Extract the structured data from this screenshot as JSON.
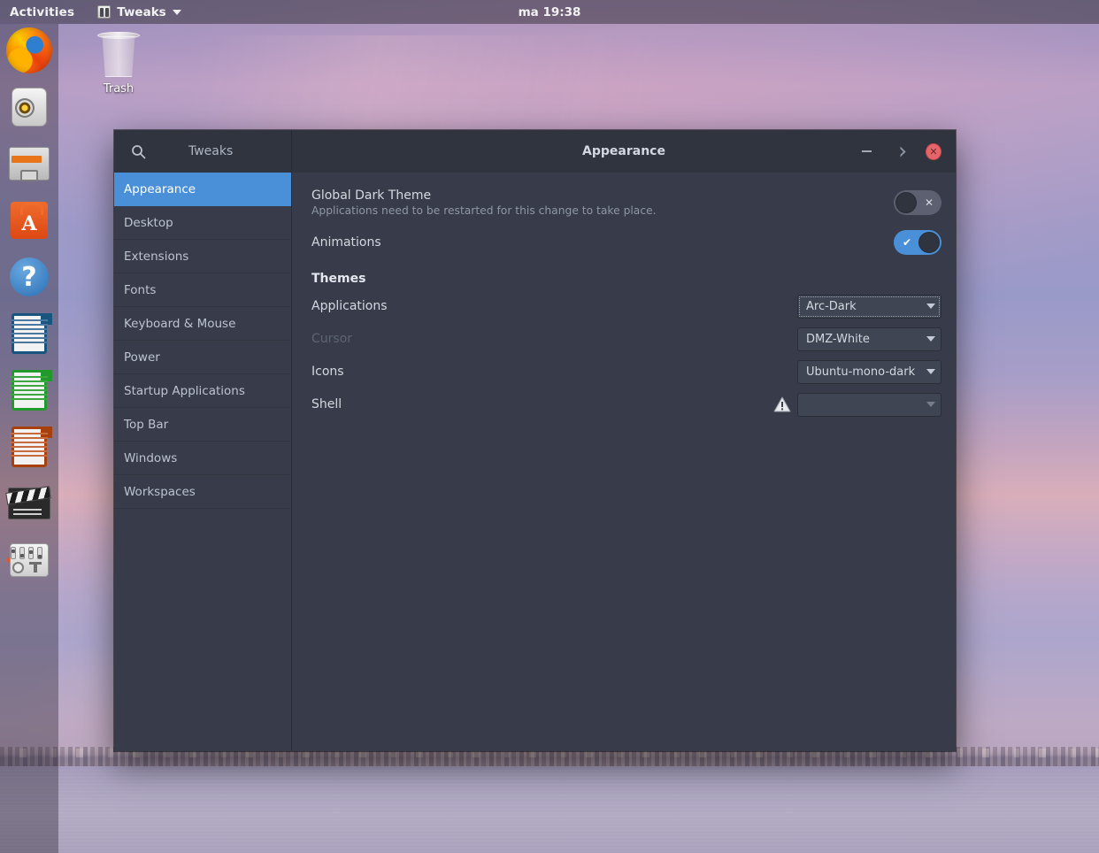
{
  "topbar": {
    "activities": "Activities",
    "app_menu": "Tweaks",
    "app_menu_icon": "tweaks-icon",
    "clock": "ma 19:38"
  },
  "desktop": {
    "icons": [
      {
        "name": "trash",
        "label": "Trash",
        "icon": "trash-can-icon"
      }
    ]
  },
  "dock": {
    "items": [
      {
        "name": "firefox",
        "label": "Firefox",
        "icon": "firefox-icon",
        "running": false
      },
      {
        "name": "rhythmbox",
        "label": "Rhythmbox",
        "icon": "speaker-icon",
        "running": false
      },
      {
        "name": "files",
        "label": "Files",
        "icon": "file-cabinet-icon",
        "running": false
      },
      {
        "name": "software",
        "label": "Ubuntu Software",
        "icon": "software-bag-icon",
        "running": false
      },
      {
        "name": "help",
        "label": "Help",
        "icon": "question-mark-icon",
        "running": false
      },
      {
        "name": "writer",
        "label": "LibreOffice Writer",
        "icon": "document-icon",
        "running": false
      },
      {
        "name": "calc",
        "label": "LibreOffice Calc",
        "icon": "spreadsheet-icon",
        "running": false
      },
      {
        "name": "impress",
        "label": "LibreOffice Impress",
        "icon": "presentation-icon",
        "running": false
      },
      {
        "name": "videoeditor",
        "label": "Video Editor",
        "icon": "clapperboard-icon",
        "running": false
      },
      {
        "name": "tweaks",
        "label": "Tweaks",
        "icon": "sliders-icon",
        "running": true
      }
    ]
  },
  "window": {
    "sidebar_header": "Tweaks",
    "search_icon": "search-icon",
    "title": "Appearance",
    "buttons": {
      "minimize": "–",
      "maximize": "⬜",
      "close": "✕"
    },
    "sidebar": {
      "items": [
        {
          "label": "Appearance",
          "active": true
        },
        {
          "label": "Desktop",
          "active": false
        },
        {
          "label": "Extensions",
          "active": false
        },
        {
          "label": "Fonts",
          "active": false
        },
        {
          "label": "Keyboard & Mouse",
          "active": false
        },
        {
          "label": "Power",
          "active": false
        },
        {
          "label": "Startup Applications",
          "active": false
        },
        {
          "label": "Top Bar",
          "active": false
        },
        {
          "label": "Windows",
          "active": false
        },
        {
          "label": "Workspaces",
          "active": false
        }
      ]
    },
    "content": {
      "global_dark_theme": {
        "label": "Global Dark Theme",
        "description": "Applications need to be restarted for this change to take place.",
        "state": "off",
        "off_mark": "✕"
      },
      "animations": {
        "label": "Animations",
        "state": "on",
        "on_mark": "✔"
      },
      "themes_heading": "Themes",
      "themes": [
        {
          "label": "Applications",
          "value": "Arc-Dark",
          "disabled": false,
          "focused": true,
          "warning": false
        },
        {
          "label": "Cursor",
          "value": "DMZ-White",
          "disabled": true,
          "focused": false,
          "warning": false
        },
        {
          "label": "Icons",
          "value": "Ubuntu-mono-dark",
          "disabled": false,
          "focused": false,
          "warning": false
        },
        {
          "label": "Shell",
          "value": "",
          "disabled": true,
          "focused": false,
          "warning": true
        }
      ]
    }
  },
  "colors": {
    "accent": "#4a90d9",
    "window_bg": "#383c4a",
    "titlebar_bg": "#2f343f",
    "close_button": "#e4656a",
    "text_primary": "#d3d8e0",
    "text_dim": "#8e96a5"
  }
}
